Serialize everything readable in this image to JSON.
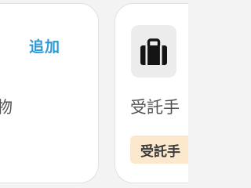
{
  "left_card": {
    "add_label": "追加",
    "item_label": "物"
  },
  "right_card": {
    "icon": "briefcase-icon",
    "item_label": "受託手",
    "badge_label": "受託手"
  }
}
